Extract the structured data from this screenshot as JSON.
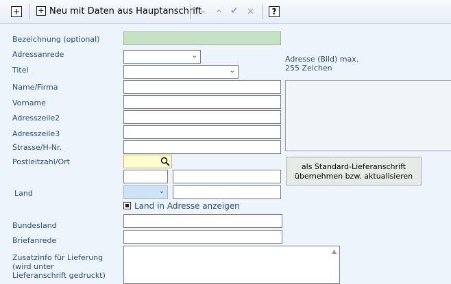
{
  "toolbar": {
    "add_icon": "plus-square-icon",
    "new_with_data_label": "Neu mit Daten aus Hauptanschrift",
    "minus_symbol": "−",
    "up_symbol": "⌃",
    "check_symbol": "✔",
    "close_symbol": "✕",
    "help_symbol": "?"
  },
  "form": {
    "bezeichnung_label": "Bezeichnung (optional)",
    "adressanrede_label": "Adressanrede",
    "titel_label": "Titel",
    "name_label": "Name/Firma",
    "vorname_label": "Vorname",
    "adresszeile2_label": "Adresszeile2",
    "adresszeile3_label": "Adresszeile3",
    "strasse_label": "Strasse/H-Nr.",
    "plz_label": "Postleitzahl/Ort",
    "land_label": "Land",
    "land_checkbox_label": "Land in Adresse anzeigen",
    "bundesland_label": "Bundesland",
    "briefanrede_label": "Briefanrede",
    "zusatzinfo_label_line1": "Zusatzinfo für Lieferung",
    "zusatzinfo_label_line2": "(wird unter",
    "zusatzinfo_label_line3": "Lieferanschrift gedruckt)"
  },
  "side": {
    "image_note_line1": "Adresse (Bild) max.",
    "image_note_line2": "255 Zeichen",
    "std_button_line1": "als Standard-Lieferanschrift",
    "std_button_line2": "übernehmen bzw. aktualisieren"
  },
  "colors": {
    "label_text": "#1f4e79",
    "bezeichnung_bg": "#c6e0c6",
    "plz_bg": "#ffffcc",
    "land_select_bg": "#cfe3f7",
    "content_bg": "#eef4fb"
  }
}
